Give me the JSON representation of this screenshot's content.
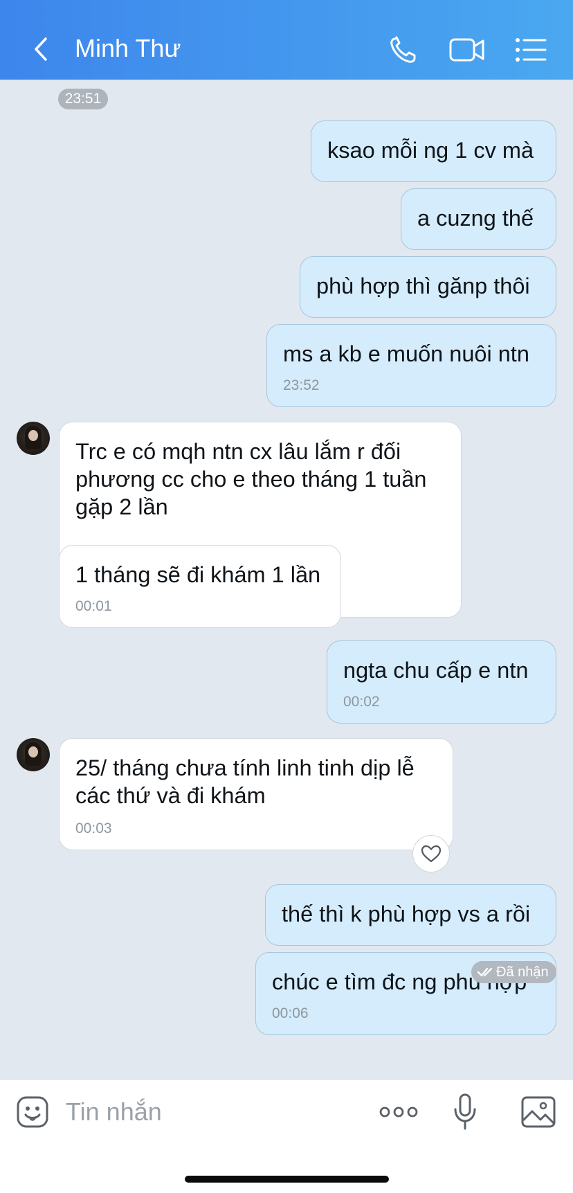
{
  "header": {
    "title": "Minh Thư",
    "back_icon": "chevron-left-icon",
    "actions": [
      "phone-icon",
      "video-call-icon",
      "menu-list-icon"
    ],
    "gradient": [
      "#3d86ec",
      "#4aa8f0"
    ]
  },
  "messages": {
    "prev_time": "23:51",
    "m1": {
      "text": "ksao mỗi ng 1 cv mà"
    },
    "m2": {
      "text": "a cuzng thế"
    },
    "m3": {
      "text": "phù hợp thì gănp thôi"
    },
    "m4": {
      "text": "ms a kb e muốn nuôi ntn",
      "time": "23:52"
    },
    "m5": {
      "text": "Trc e có mqh ntn cx lâu lắm r đối phương cc cho e theo tháng 1 tuần gặp 2 lần"
    },
    "m6": {
      "text": "1 tháng sẽ đi khám 1 lần",
      "time": "00:01"
    },
    "m7": {
      "text": "ngta chu cấp e ntn",
      "time": "00:02"
    },
    "m8": {
      "text": "25/ tháng chưa tính linh tinh dịp lễ các thứ và đi khám",
      "time": "00:03"
    },
    "m9": {
      "text": "thế thì k phù hợp vs a rồi"
    },
    "m10": {
      "text": "chúc e tìm đc ng phù hợp",
      "time": "00:06"
    },
    "status": "Đã nhận"
  },
  "input": {
    "placeholder": "Tin nhắn",
    "icons": [
      "sticker-icon",
      "more-icon",
      "microphone-icon",
      "image-icon"
    ]
  },
  "colors": {
    "sent_bubble": "#d4ecfb",
    "received_bubble": "#ffffff",
    "chat_background": "#e2e8ef"
  }
}
